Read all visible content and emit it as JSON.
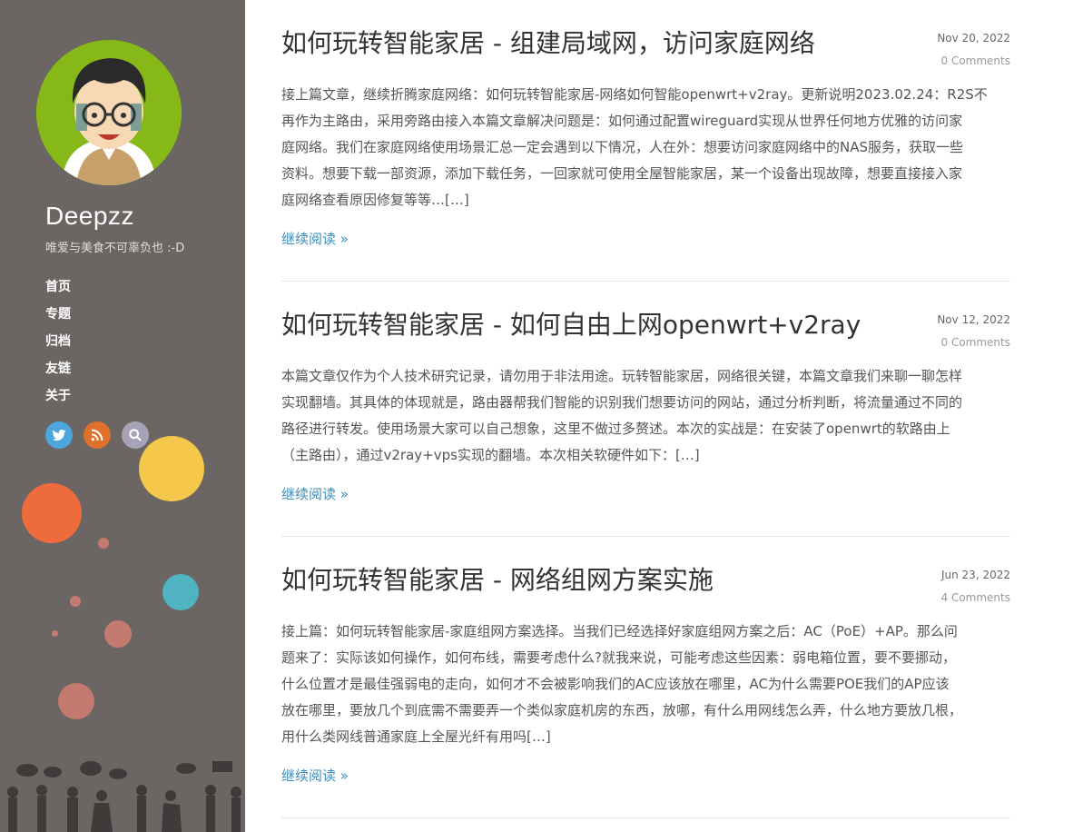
{
  "site": {
    "title": "Deepzz",
    "description": "唯爱与美食不可辜负也 :-D"
  },
  "nav": [
    {
      "label": "首页"
    },
    {
      "label": "专题"
    },
    {
      "label": "归档"
    },
    {
      "label": "友链"
    },
    {
      "label": "关于"
    }
  ],
  "social": [
    {
      "icon": "twitter-icon",
      "color": "#4da7de"
    },
    {
      "icon": "rss-icon",
      "color": "#e0712c"
    },
    {
      "icon": "search-icon",
      "color": "#a7a3b6"
    }
  ],
  "colors": {
    "sidebar_bg": "#6b6663",
    "link": "#3b8dbd",
    "avatar_bg": "#86b817"
  },
  "posts": [
    {
      "title": "如何玩转智能家居 - 组建局域网，访问家庭网络",
      "date": "Nov 20, 2022",
      "comments": "0 Comments",
      "excerpt_lines": [
        "接上篇文章，继续折腾家庭网络：如何玩转智能家居-网络如何智能openwrt+v2ray。更新说明2023.02.24：R2S不",
        "再作为主路由，采用旁路由接入本篇文章解决问题是：如何通过配置wireguard实现从世界任何地方优雅的访问家",
        "庭网络。我们在家庭网络使用场景汇总一定会遇到以下情况，人在外：想要访问家庭网络中的NAS服务，获取一些",
        "资料。想要下载一部资源，添加下载任务，一回家就可使用全屋智能家居，某一个设备出现故障，想要直接接入家",
        "庭网络查看原因修复等等…[…]"
      ],
      "read_more": "继续阅读 »"
    },
    {
      "title": "如何玩转智能家居 - 如何自由上网openwrt+v2ray",
      "date": "Nov 12, 2022",
      "comments": "0 Comments",
      "excerpt_lines": [
        "本篇文章仅作为个人技术研究记录，请勿用于非法用途。玩转智能家居，网络很关键，本篇文章我们来聊一聊怎样",
        "实现翻墙。其具体的体现就是，路由器帮我们智能的识别我们想要访问的网站，通过分析判断，将流量通过不同的",
        "路径进行转发。使用场景大家可以自己想象，这里不做过多赘述。本次的实战是：在安装了openwrt的软路由上",
        "（主路由），通过v2ray+vps实现的翻墙。本次相关软硬件如下：[…]"
      ],
      "read_more": "继续阅读 »"
    },
    {
      "title": "如何玩转智能家居 - 网络组网方案实施",
      "date": "Jun 23, 2022",
      "comments": "4 Comments",
      "excerpt_lines": [
        "接上篇：如何玩转智能家居-家庭组网方案选择。当我们已经选择好家庭组网方案之后：AC（PoE）+AP。那么问",
        "题来了：实际该如何操作，如何布线，需要考虑什么?就我来说，可能考虑这些因素：弱电箱位置，要不要挪动，",
        "什么位置才是最佳强弱电的走向，如何才不会被影响我们的AC应该放在哪里，AC为什么需要POE我们的AP应该",
        "放在哪里，要放几个到底需不需要弄一个类似家庭机房的东西，放哪，有什么用网线怎么弄，什么地方要放几根，",
        "用什么类网线普通家庭上全屋光纤有用吗[…]"
      ],
      "read_more": "继续阅读 »"
    }
  ]
}
